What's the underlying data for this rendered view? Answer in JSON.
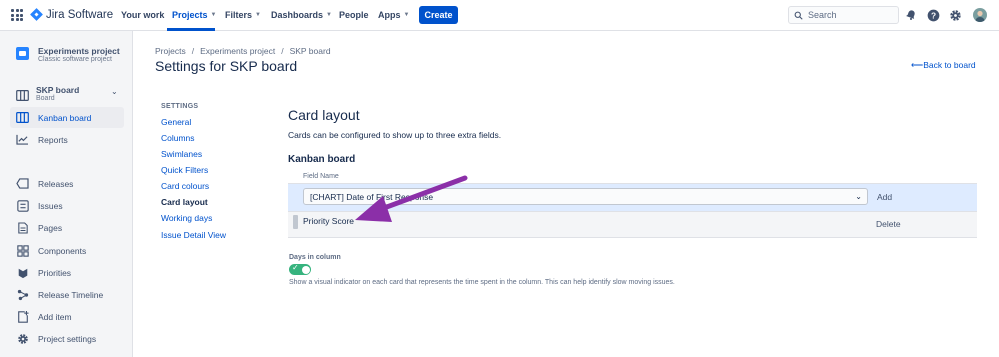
{
  "topnav": {
    "product": "Jira Software",
    "items": [
      {
        "label": "Your work",
        "chevron": false,
        "active": false
      },
      {
        "label": "Projects",
        "chevron": true,
        "active": true
      },
      {
        "label": "Filters",
        "chevron": true,
        "active": false
      },
      {
        "label": "Dashboards",
        "chevron": true,
        "active": false
      },
      {
        "label": "People",
        "chevron": false,
        "active": false
      },
      {
        "label": "Apps",
        "chevron": true,
        "active": false
      }
    ],
    "create_label": "Create",
    "search_placeholder": "Search",
    "accent_color": "#0052cc"
  },
  "sidebar": {
    "project_name": "Experiments project",
    "project_type": "Classic software project",
    "board_name": "SKP board",
    "board_sub": "Board",
    "items": [
      {
        "label": "Kanban board",
        "icon": "kanban-board-icon",
        "active": true
      },
      {
        "label": "Reports",
        "icon": "reports-icon",
        "active": false
      },
      {
        "label": "Releases",
        "icon": "releases-icon",
        "active": false
      },
      {
        "label": "Issues",
        "icon": "issues-icon",
        "active": false
      },
      {
        "label": "Pages",
        "icon": "pages-icon",
        "active": false
      },
      {
        "label": "Components",
        "icon": "components-icon",
        "active": false
      },
      {
        "label": "Priorities",
        "icon": "priorities-icon",
        "active": false
      },
      {
        "label": "Release Timeline",
        "icon": "release-timeline-icon",
        "active": false
      },
      {
        "label": "Add item",
        "icon": "add-item-icon",
        "active": false
      },
      {
        "label": "Project settings",
        "icon": "gear-icon",
        "active": false
      }
    ]
  },
  "breadcrumb": [
    "Projects",
    "Experiments project",
    "SKP board"
  ],
  "page_title": "Settings for SKP board",
  "back_link": "Back to board",
  "settings_nav": {
    "heading": "SETTINGS",
    "items": [
      {
        "label": "General",
        "current": false
      },
      {
        "label": "Columns",
        "current": false
      },
      {
        "label": "Swimlanes",
        "current": false
      },
      {
        "label": "Quick Filters",
        "current": false
      },
      {
        "label": "Card colours",
        "current": false
      },
      {
        "label": "Card layout",
        "current": true
      },
      {
        "label": "Working days",
        "current": false
      },
      {
        "label": "Issue Detail View",
        "current": false
      }
    ]
  },
  "card_layout": {
    "title": "Card layout",
    "description": "Cards can be configured to show up to three extra fields.",
    "board_section": "Kanban board",
    "field_header": "Field Name",
    "select_value": "[CHART] Date of First Response",
    "add_label": "Add",
    "fields": [
      {
        "name": "Priority Score",
        "action": "Delete"
      }
    ]
  },
  "days_in_column": {
    "label": "Days in column",
    "enabled": true,
    "description": "Show a visual indicator on each card that represents the time spent in the column. This can help identify slow moving issues."
  },
  "annotation": {
    "arrow_color": "#8b2fa8"
  }
}
